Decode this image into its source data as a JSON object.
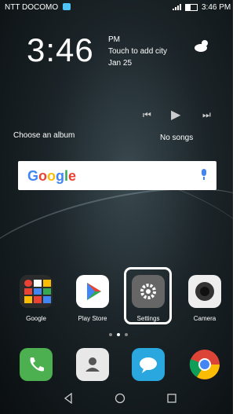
{
  "status_bar": {
    "carrier": "NTT DOCOMO",
    "time": "3:46 PM"
  },
  "clock": {
    "time": "3:46",
    "ampm": "PM",
    "city": "Touch to add city",
    "date": "Jan 25"
  },
  "music": {
    "album": "Choose an album",
    "song": "No songs"
  },
  "search": {
    "logo": "Google"
  },
  "apps": [
    {
      "label": "Google"
    },
    {
      "label": "Play Store"
    },
    {
      "label": "Settings"
    },
    {
      "label": "Camera"
    }
  ],
  "colors": {
    "highlight_frame": "#ffffff",
    "dock_phone": "#4caf50",
    "dock_messages": "#29a7de"
  }
}
